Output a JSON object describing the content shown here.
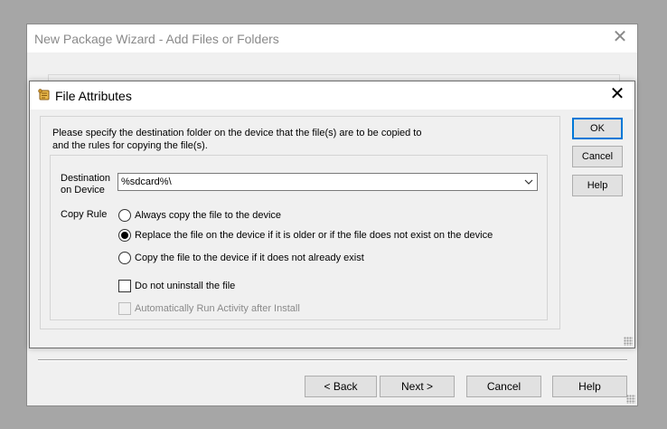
{
  "wizard": {
    "title": "New Package Wizard - Add Files or Folders",
    "close_glyph": "✕",
    "buttons": {
      "back": "< Back",
      "next": "Next >",
      "cancel": "Cancel",
      "help": "Help"
    }
  },
  "dialog": {
    "title": "File Attributes",
    "icon": "scroll-icon",
    "close_glyph": "✕",
    "instructions": "Please specify the destination folder on the device that the file(s) are to be copied to\nand the rules for copying the file(s).",
    "destination": {
      "label": "Destination\non Device",
      "value": "%sdcard%\\"
    },
    "copy_rule": {
      "label": "Copy Rule",
      "options": [
        {
          "label": "Always copy the file to the device",
          "checked": false
        },
        {
          "label": "Replace the file on the device if it is older or if the file does not exist on the device",
          "checked": true
        },
        {
          "label": "Copy the file to the device if it does not already exist",
          "checked": false
        }
      ]
    },
    "checkboxes": {
      "do_not_uninstall": {
        "label": "Do not uninstall the file",
        "checked": false,
        "enabled": true
      },
      "auto_run": {
        "label": "Automatically Run Activity after Install",
        "checked": false,
        "enabled": false
      }
    },
    "buttons": {
      "ok": "OK",
      "cancel": "Cancel",
      "help": "Help"
    }
  },
  "colors": {
    "desktop": "#a6a6a6",
    "window_bg": "#f0f0f0",
    "default_button_border": "#0078d7",
    "disabled_text": "#8a8a8a"
  }
}
